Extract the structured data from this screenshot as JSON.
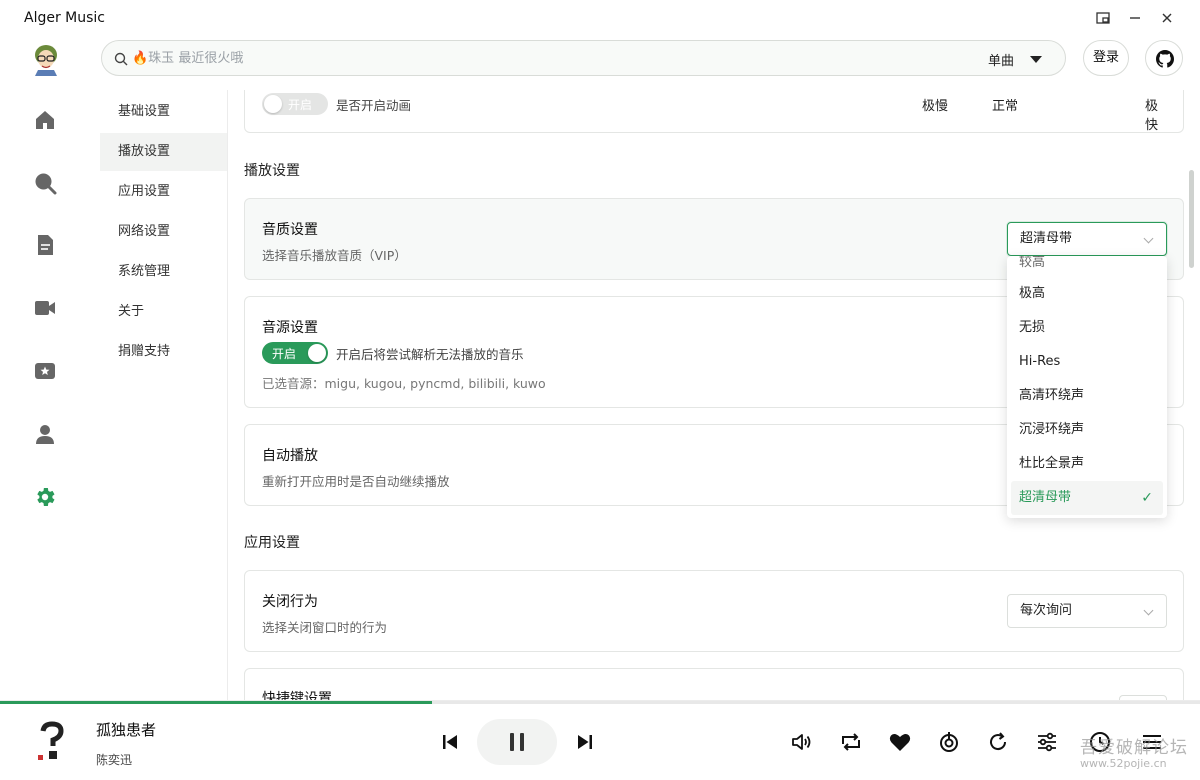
{
  "window": {
    "title": "Alger Music",
    "controls": [
      "pip-icon",
      "minimize-icon",
      "close-icon"
    ]
  },
  "header": {
    "search": {
      "value": "",
      "placeholder": "🔥珠玉 最近很火哦"
    },
    "search_type": "单曲",
    "login_label": "登录"
  },
  "sidebar": {
    "icons": [
      "home-icon",
      "search-icon",
      "document-icon",
      "video-icon",
      "star-card-icon",
      "user-icon",
      "settings-icon"
    ],
    "active": "settings-icon",
    "active_color": "#2a9a5a"
  },
  "settings_menu": {
    "items": [
      {
        "label": "基础设置"
      },
      {
        "label": "播放设置"
      },
      {
        "label": "应用设置"
      },
      {
        "label": "网络设置"
      },
      {
        "label": "系统管理"
      },
      {
        "label": "关于"
      },
      {
        "label": "捐赠支持"
      }
    ],
    "active_index": 1
  },
  "animation_row": {
    "toggle_label": "开启",
    "description": "是否开启动画",
    "speed_labels": [
      "极慢",
      "正常",
      "极快"
    ]
  },
  "playback_section": {
    "heading": "播放设置",
    "quality": {
      "title": "音质设置",
      "description": "选择音乐播放音质（VIP）",
      "selected": "超清母带",
      "options": [
        "较高",
        "极高",
        "无损",
        "Hi-Res",
        "高清环绕声",
        "沉浸环绕声",
        "杜比全景声",
        "超清母带"
      ]
    },
    "source": {
      "title": "音源设置",
      "toggle_label": "开启",
      "description": "开启后将尝试解析无法播放的音乐",
      "selected_sources": "已选音源：migu, kugou, pyncmd, bilibili, kuwo"
    },
    "autoplay": {
      "title": "自动播放",
      "description": "重新打开应用时是否自动继续播放"
    }
  },
  "app_section": {
    "heading": "应用设置",
    "close_behavior": {
      "title": "关闭行为",
      "description": "选择关闭窗口时的行为",
      "selected": "每次询问"
    },
    "shortcut": {
      "title": "快捷键设置"
    }
  },
  "player": {
    "title": "孤独患者",
    "artist": "陈奕迅",
    "progress": 0.36,
    "accent": "#2a9a5a",
    "controls": [
      "previous-icon",
      "pause-icon",
      "next-icon",
      "volume-icon",
      "repeat-icon",
      "heart-icon",
      "intelligence-mode-icon",
      "refresh-icon",
      "equalizer-icon",
      "timer-icon",
      "playlist-icon"
    ]
  },
  "watermark": {
    "text": "吾爱破解论坛",
    "url": "www.52pojie.cn"
  }
}
